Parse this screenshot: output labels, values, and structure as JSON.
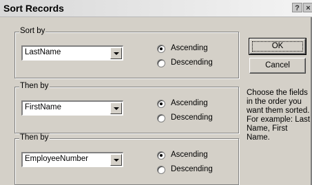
{
  "window": {
    "title": "Sort Records",
    "help_button": "?",
    "close_button": "×"
  },
  "groups": [
    {
      "label": "Sort by",
      "field": "LastName",
      "options": [
        "Ascending",
        "Descending"
      ],
      "selected": "Ascending"
    },
    {
      "label": "Then by",
      "field": "FirstName",
      "options": [
        "Ascending",
        "Descending"
      ],
      "selected": "Ascending"
    },
    {
      "label": "Then by",
      "field": "EmployeeNumber",
      "options": [
        "Ascending",
        "Descending"
      ],
      "selected": "Ascending"
    }
  ],
  "buttons": {
    "ok": "OK",
    "cancel": "Cancel"
  },
  "help_text": "Choose the fields\nin the order you\nwant them sorted.\nFor example: Last\nName, First\nName."
}
